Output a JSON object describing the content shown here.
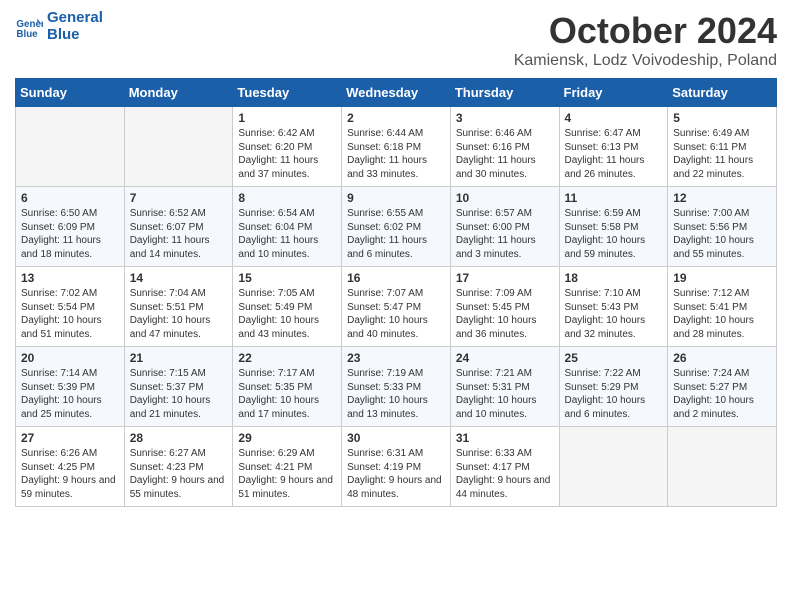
{
  "header": {
    "logo_line1": "General",
    "logo_line2": "Blue",
    "month": "October 2024",
    "location": "Kamiensk, Lodz Voivodeship, Poland"
  },
  "days_of_week": [
    "Sunday",
    "Monday",
    "Tuesday",
    "Wednesday",
    "Thursday",
    "Friday",
    "Saturday"
  ],
  "weeks": [
    [
      {
        "day": "",
        "info": ""
      },
      {
        "day": "",
        "info": ""
      },
      {
        "day": "1",
        "info": "Sunrise: 6:42 AM\nSunset: 6:20 PM\nDaylight: 11 hours and 37 minutes."
      },
      {
        "day": "2",
        "info": "Sunrise: 6:44 AM\nSunset: 6:18 PM\nDaylight: 11 hours and 33 minutes."
      },
      {
        "day": "3",
        "info": "Sunrise: 6:46 AM\nSunset: 6:16 PM\nDaylight: 11 hours and 30 minutes."
      },
      {
        "day": "4",
        "info": "Sunrise: 6:47 AM\nSunset: 6:13 PM\nDaylight: 11 hours and 26 minutes."
      },
      {
        "day": "5",
        "info": "Sunrise: 6:49 AM\nSunset: 6:11 PM\nDaylight: 11 hours and 22 minutes."
      }
    ],
    [
      {
        "day": "6",
        "info": "Sunrise: 6:50 AM\nSunset: 6:09 PM\nDaylight: 11 hours and 18 minutes."
      },
      {
        "day": "7",
        "info": "Sunrise: 6:52 AM\nSunset: 6:07 PM\nDaylight: 11 hours and 14 minutes."
      },
      {
        "day": "8",
        "info": "Sunrise: 6:54 AM\nSunset: 6:04 PM\nDaylight: 11 hours and 10 minutes."
      },
      {
        "day": "9",
        "info": "Sunrise: 6:55 AM\nSunset: 6:02 PM\nDaylight: 11 hours and 6 minutes."
      },
      {
        "day": "10",
        "info": "Sunrise: 6:57 AM\nSunset: 6:00 PM\nDaylight: 11 hours and 3 minutes."
      },
      {
        "day": "11",
        "info": "Sunrise: 6:59 AM\nSunset: 5:58 PM\nDaylight: 10 hours and 59 minutes."
      },
      {
        "day": "12",
        "info": "Sunrise: 7:00 AM\nSunset: 5:56 PM\nDaylight: 10 hours and 55 minutes."
      }
    ],
    [
      {
        "day": "13",
        "info": "Sunrise: 7:02 AM\nSunset: 5:54 PM\nDaylight: 10 hours and 51 minutes."
      },
      {
        "day": "14",
        "info": "Sunrise: 7:04 AM\nSunset: 5:51 PM\nDaylight: 10 hours and 47 minutes."
      },
      {
        "day": "15",
        "info": "Sunrise: 7:05 AM\nSunset: 5:49 PM\nDaylight: 10 hours and 43 minutes."
      },
      {
        "day": "16",
        "info": "Sunrise: 7:07 AM\nSunset: 5:47 PM\nDaylight: 10 hours and 40 minutes."
      },
      {
        "day": "17",
        "info": "Sunrise: 7:09 AM\nSunset: 5:45 PM\nDaylight: 10 hours and 36 minutes."
      },
      {
        "day": "18",
        "info": "Sunrise: 7:10 AM\nSunset: 5:43 PM\nDaylight: 10 hours and 32 minutes."
      },
      {
        "day": "19",
        "info": "Sunrise: 7:12 AM\nSunset: 5:41 PM\nDaylight: 10 hours and 28 minutes."
      }
    ],
    [
      {
        "day": "20",
        "info": "Sunrise: 7:14 AM\nSunset: 5:39 PM\nDaylight: 10 hours and 25 minutes."
      },
      {
        "day": "21",
        "info": "Sunrise: 7:15 AM\nSunset: 5:37 PM\nDaylight: 10 hours and 21 minutes."
      },
      {
        "day": "22",
        "info": "Sunrise: 7:17 AM\nSunset: 5:35 PM\nDaylight: 10 hours and 17 minutes."
      },
      {
        "day": "23",
        "info": "Sunrise: 7:19 AM\nSunset: 5:33 PM\nDaylight: 10 hours and 13 minutes."
      },
      {
        "day": "24",
        "info": "Sunrise: 7:21 AM\nSunset: 5:31 PM\nDaylight: 10 hours and 10 minutes."
      },
      {
        "day": "25",
        "info": "Sunrise: 7:22 AM\nSunset: 5:29 PM\nDaylight: 10 hours and 6 minutes."
      },
      {
        "day": "26",
        "info": "Sunrise: 7:24 AM\nSunset: 5:27 PM\nDaylight: 10 hours and 2 minutes."
      }
    ],
    [
      {
        "day": "27",
        "info": "Sunrise: 6:26 AM\nSunset: 4:25 PM\nDaylight: 9 hours and 59 minutes."
      },
      {
        "day": "28",
        "info": "Sunrise: 6:27 AM\nSunset: 4:23 PM\nDaylight: 9 hours and 55 minutes."
      },
      {
        "day": "29",
        "info": "Sunrise: 6:29 AM\nSunset: 4:21 PM\nDaylight: 9 hours and 51 minutes."
      },
      {
        "day": "30",
        "info": "Sunrise: 6:31 AM\nSunset: 4:19 PM\nDaylight: 9 hours and 48 minutes."
      },
      {
        "day": "31",
        "info": "Sunrise: 6:33 AM\nSunset: 4:17 PM\nDaylight: 9 hours and 44 minutes."
      },
      {
        "day": "",
        "info": ""
      },
      {
        "day": "",
        "info": ""
      }
    ]
  ]
}
